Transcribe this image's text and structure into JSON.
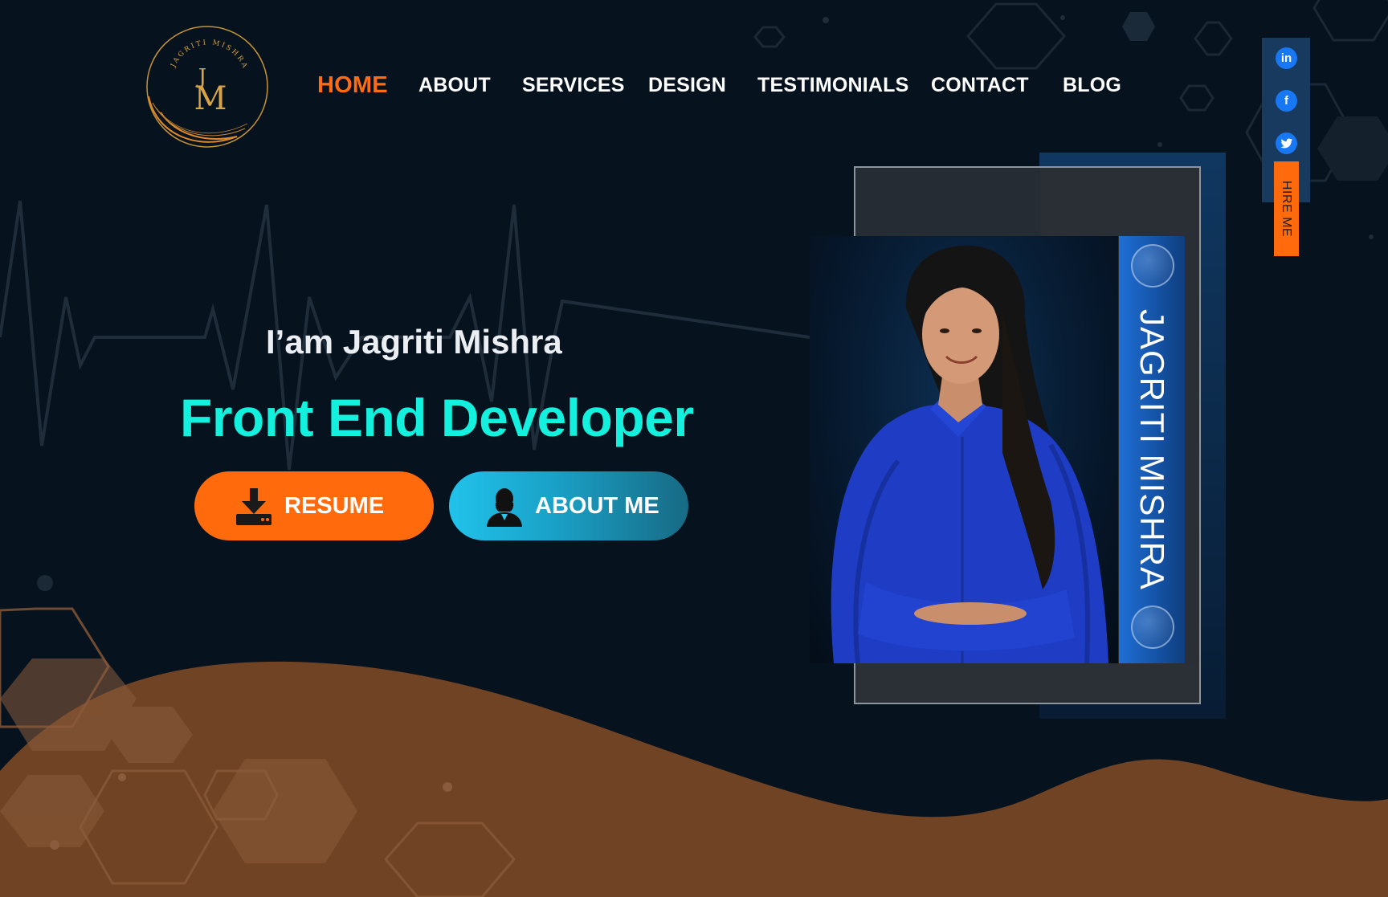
{
  "brand": {
    "logo_ring_text": "JAGRITI MISHRA",
    "logo_monogram_top": "J",
    "logo_monogram_bottom": "M"
  },
  "nav": {
    "items": [
      {
        "label": "HOME",
        "active": true
      },
      {
        "label": "ABOUT",
        "active": false
      },
      {
        "label": "SERVICES",
        "active": false
      },
      {
        "label": "DESIGN",
        "active": false
      },
      {
        "label": "TESTIMONIALS",
        "active": false
      },
      {
        "label": "CONTACT",
        "active": false
      },
      {
        "label": "BLOG",
        "active": false
      }
    ]
  },
  "hero": {
    "intro": "I’am Jagriti Mishra",
    "role": "Front End Developer",
    "resume_label": "RESUME",
    "about_label": "ABOUT ME",
    "resume_icon": "download-icon",
    "about_icon": "person-icon"
  },
  "profile": {
    "name_vertical": "JAGRITI MISHRA"
  },
  "social": {
    "linkedin_glyph": "in",
    "facebook_glyph": "f",
    "twitter_glyph": "t",
    "hire_label": "HIRE ME"
  },
  "colors": {
    "background": "#06121d",
    "accent_orange": "#ff6b0c",
    "accent_cyan": "#13f0dd",
    "wave_brown": "#6f4323",
    "gold": "#d9a441"
  }
}
